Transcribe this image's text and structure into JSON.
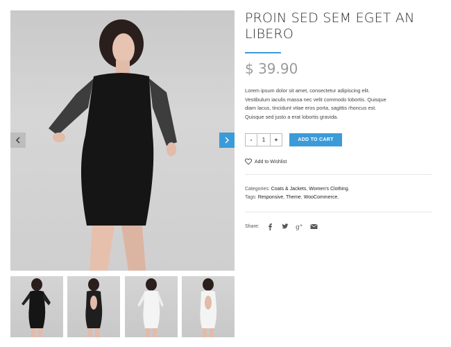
{
  "gallery": {
    "prev_label": "previous",
    "next_label": "next",
    "accent_color": "#3b9bd8",
    "thumbnails": [
      "black-dress-front",
      "black-dress-back",
      "white-dress-front",
      "white-dress-back"
    ]
  },
  "product": {
    "title_line1": "PROIN SED SEM EGET AN",
    "title_line2": "LIBERO",
    "price": "$ 39.90",
    "description": "Lorem ipsum dolor sit amet, consectetur adipiscing elit. Vestibulum iaculis massa nec velit commodo lobortis. Quisque diam lacus, tincidunt vitae eros porta, sagittis rhoncus est. Quisque sed justo a erat lobortis gravida."
  },
  "cart": {
    "minus": "-",
    "quantity": "1",
    "plus": "+",
    "add_to_cart": "ADD TO CART"
  },
  "wishlist": {
    "label": "Add to Wishlist",
    "icon": "heart-icon"
  },
  "meta": {
    "categories_label": "Categories:",
    "categories": [
      "Coats & Jackets",
      "Women's Clothing."
    ],
    "tags_label": "Tags:",
    "tags": [
      "Responsive",
      "Theme",
      "WooCommerce."
    ]
  },
  "share": {
    "label": "Share:",
    "icons": [
      "facebook-icon",
      "twitter-icon",
      "google-plus-icon",
      "email-icon"
    ]
  }
}
